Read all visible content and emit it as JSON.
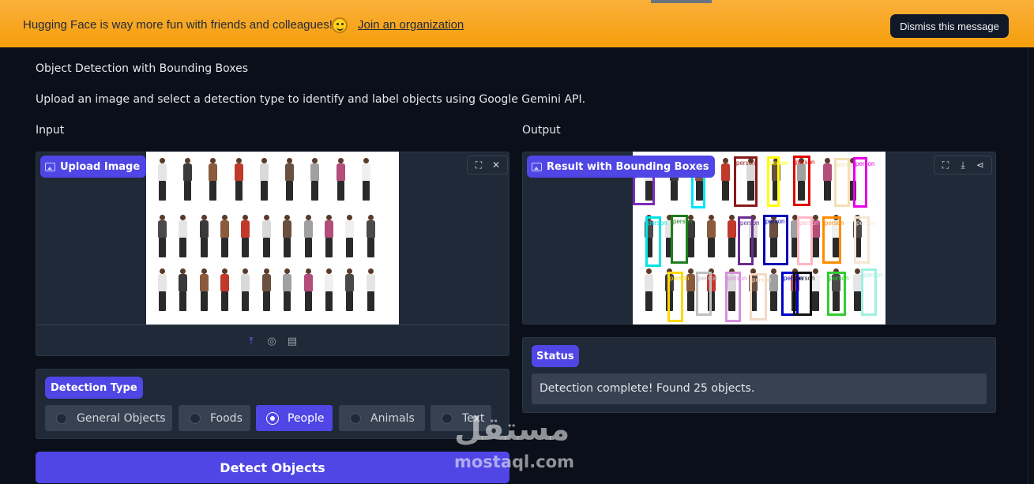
{
  "banner": {
    "message": "Hugging Face is way more fun with friends and colleagues!",
    "emoji_icon": "hugging-face-emoji-icon",
    "join_link": "Join an organization",
    "dismiss_label": "Dismiss this message",
    "background_color": "#f59e0b"
  },
  "app": {
    "title": "Object Detection with Bounding Boxes",
    "description": "Upload an image and select a detection type to identify and label objects using Google Gemini API."
  },
  "input": {
    "section_label": "Input",
    "upload_label": "Upload Image",
    "toolbar_icons": [
      "fullscreen-icon",
      "close-icon"
    ],
    "source_icons": [
      "upload-icon",
      "webcam-icon",
      "clipboard-icon"
    ]
  },
  "detection_type": {
    "label": "Detection Type",
    "options": [
      "General Objects",
      "Foods",
      "People",
      "Animals",
      "Text"
    ],
    "selected": "People"
  },
  "detect_button": {
    "label": "Detect Objects"
  },
  "output": {
    "section_label": "Output",
    "result_label": "Result with Bounding Boxes",
    "toolbar_icons": [
      "fullscreen-icon",
      "download-icon",
      "share-icon"
    ],
    "box_label": "person"
  },
  "status": {
    "label": "Status",
    "message": "Detection complete! Found 25 objects."
  },
  "watermark": {
    "arabic": "مستقل",
    "latin": "mostaql.com"
  },
  "colors": {
    "accent": "#4f46e5",
    "background": "#0b0f19",
    "panel": "#1f2937"
  }
}
